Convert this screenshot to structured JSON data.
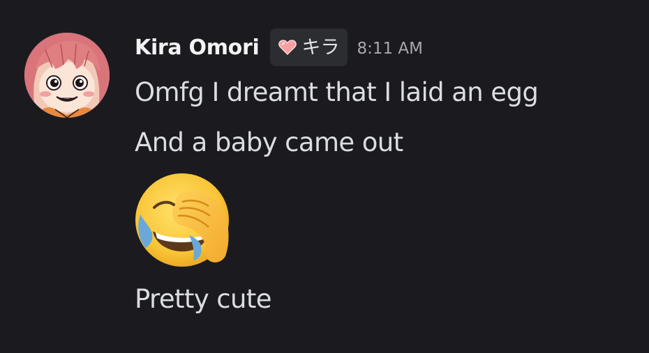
{
  "message": {
    "author": {
      "name": "Kira Omori",
      "tag_text": "キラ",
      "tag_icon": "pink-heart-icon",
      "avatar_icon": "kira-avatar"
    },
    "timestamp": "8:11 AM",
    "lines": [
      "Omfg I dreamt that I laid an egg",
      "And a baby came out",
      "Pretty cute"
    ],
    "emoji": "face-palm-laughing-emoji"
  },
  "colors": {
    "background": "#1b1b1f",
    "username": "#f2f3f5",
    "text": "#dbdee1",
    "timestamp": "#a7a9ae",
    "tag_background": "#2b2d31"
  }
}
